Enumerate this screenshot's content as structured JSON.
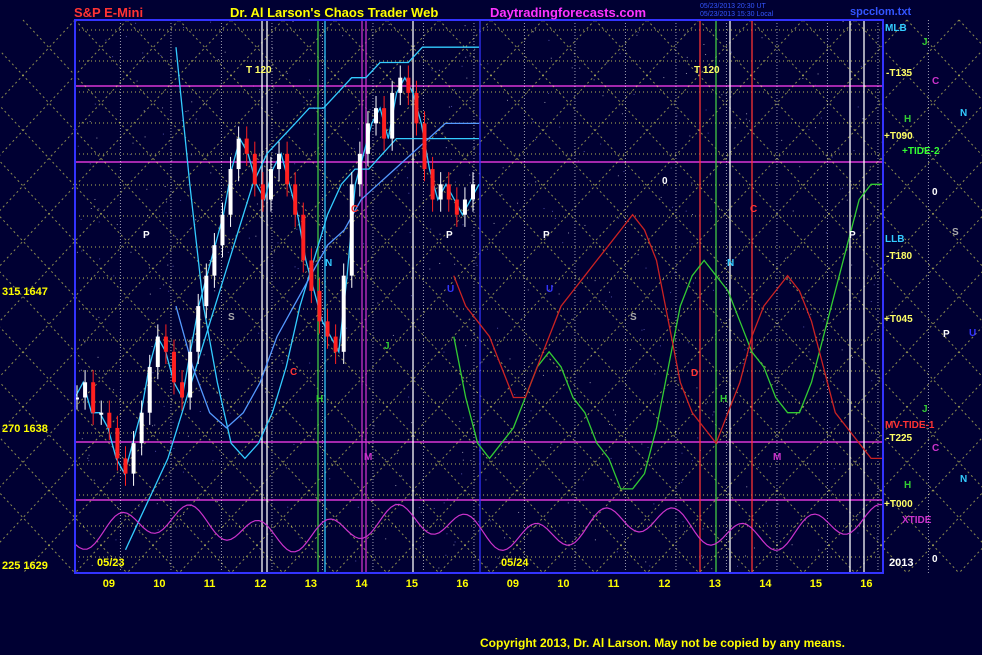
{
  "header": {
    "left_title": "S&P E-Mini",
    "center_title": "Dr. Al Larson's Chaos Trader Web",
    "site": "Daytradingforecasts.com",
    "file_name": "spcclom.txt",
    "timestamp_line1": "05/23/2013 20:30 UT",
    "timestamp_line2": "05/23/2013 15:30 Local"
  },
  "footer": {
    "copyright": "Copyright 2013, Dr. Al Larson. May not be copied by any means."
  },
  "colors": {
    "background": "#000033",
    "frame": "#3333ff",
    "price_up": "#ffffff",
    "price_down": "#ff2020",
    "grid_yellow": "#ffff66",
    "grid_magenta": "#cc33cc",
    "grid_green": "#44cc44",
    "tide_cyan": "#33ccff",
    "band_green": "#33cc33",
    "band_red": "#cc2222",
    "osc_magenta": "#cc33cc"
  },
  "chart_data": {
    "type": "candlestick",
    "title": "S&P E-Mini",
    "y_left_labels": [
      {
        "angle": "315",
        "price": "1647",
        "value": 1647
      },
      {
        "angle": "270",
        "price": "1638",
        "value": 1638
      },
      {
        "angle": "225",
        "price": "1629",
        "value": 1629
      }
    ],
    "ylim": [
      1629,
      1664
    ],
    "x_tick_labels": [
      "09",
      "10",
      "11",
      "12",
      "13",
      "14",
      "15",
      "16",
      "09",
      "10",
      "11",
      "12",
      "13",
      "14",
      "15",
      "16"
    ],
    "date_labels": [
      {
        "text": "05/23",
        "slot": 0
      },
      {
        "text": "05/24",
        "slot": 8
      }
    ],
    "year_label": "2013",
    "right_labels": [
      {
        "text": "MLB",
        "color": "#33ccff",
        "level": "top"
      },
      {
        "text": "J",
        "color": "#33cc33",
        "level": "top"
      },
      {
        "text": "-T135",
        "color": "#ffff66",
        "level": "top"
      },
      {
        "text": "C",
        "color": "#cc33cc",
        "level": "top"
      },
      {
        "text": "N",
        "color": "#33ccff",
        "level": "top"
      },
      {
        "text": "H",
        "color": "#33cc33",
        "level": "top"
      },
      {
        "text": "+T090",
        "color": "#ffff66",
        "level": "top"
      },
      {
        "text": "+TIDE-2",
        "color": "#33ff33",
        "level": "top"
      },
      {
        "text": "0",
        "color": "#ffffff",
        "level": "top"
      },
      {
        "text": "LLB",
        "color": "#33ccff",
        "level": "mid"
      },
      {
        "text": "S",
        "color": "#aaaaaa",
        "level": "mid"
      },
      {
        "text": "-T180",
        "color": "#ffff66",
        "level": "mid"
      },
      {
        "text": "+T045",
        "color": "#ffff66",
        "level": "mid"
      },
      {
        "text": "P",
        "color": "#ffffff",
        "level": "mid"
      },
      {
        "text": "U",
        "color": "#3333ff",
        "level": "mid"
      },
      {
        "text": "J",
        "color": "#33cc33",
        "level": "low"
      },
      {
        "text": "MV-TIDE-1",
        "color": "#ff3333",
        "level": "low"
      },
      {
        "text": "-T225",
        "color": "#ffff66",
        "level": "low"
      },
      {
        "text": "C",
        "color": "#cc33cc",
        "level": "low"
      },
      {
        "text": "N",
        "color": "#33ccff",
        "level": "low"
      },
      {
        "text": "H",
        "color": "#33cc33",
        "level": "low"
      },
      {
        "text": "+T000",
        "color": "#ffff66",
        "level": "low"
      },
      {
        "text": "XTIDE",
        "color": "#cc33cc",
        "level": "low"
      },
      {
        "text": "0",
        "color": "#ffffff",
        "level": "low"
      }
    ],
    "chart_annotations": [
      {
        "text": "T 120",
        "color": "#ffff66"
      },
      {
        "text": "T 120",
        "color": "#ffff66"
      },
      {
        "text": "P",
        "color": "#ffffff"
      },
      {
        "text": "S",
        "color": "#aaaaaa"
      },
      {
        "text": "N",
        "color": "#33ccff"
      },
      {
        "text": "J",
        "color": "#33cc33"
      },
      {
        "text": "H",
        "color": "#33cc33"
      },
      {
        "text": "M",
        "color": "#cc33cc"
      },
      {
        "text": "C",
        "color": "#ff3333"
      },
      {
        "text": "U",
        "color": "#3333ff"
      },
      {
        "text": "0",
        "color": "#ffffff"
      }
    ],
    "series": [
      {
        "values": [
          1640,
          1641,
          1639,
          1639,
          1638,
          1636,
          1635,
          1637,
          1639,
          1642,
          1644,
          1643,
          1641,
          1640,
          1643,
          1646,
          1648,
          1650,
          1652,
          1655,
          1657,
          1656,
          1654,
          1653,
          1655,
          1656,
          1654,
          1652,
          1649,
          1647,
          1645,
          1644,
          1643,
          1648,
          1654,
          1656,
          1658,
          1659,
          1657,
          1660,
          1661,
          1660,
          1658,
          1655,
          1653,
          1654,
          1653,
          1652,
          1653,
          1654
        ]
      },
      {
        "values": [
          1630,
          1632,
          1634,
          1636,
          1639,
          1642,
          1645,
          1648,
          1651,
          1654,
          1656,
          1657,
          1658,
          1659,
          1659,
          1660,
          1661,
          1661,
          1662,
          1662,
          1662,
          1663,
          1663,
          1663,
          1663,
          1663
        ]
      },
      {
        "values": [
          1663,
          1654,
          1646,
          1641,
          1637,
          1636,
          1637,
          1639,
          1642,
          1646,
          1649,
          1652,
          1654,
          1655,
          1655,
          1656,
          1657,
          1657,
          1657,
          1657,
          1657,
          1657,
          1657
        ]
      },
      {
        "values": [
          1646,
          1642,
          1639,
          1638,
          1639,
          1641,
          1644,
          1646,
          1648,
          1650,
          1651,
          1653,
          1654,
          1655,
          1656,
          1657,
          1658,
          1658,
          1658
        ]
      },
      {
        "values": [
          1644,
          1640,
          1637,
          1636,
          1637,
          1638,
          1640,
          1642,
          1643,
          1642,
          1640,
          1639,
          1637,
          1636,
          1634,
          1634,
          1635,
          1638,
          1642,
          1646,
          1648,
          1649,
          1648,
          1647,
          1645,
          1643,
          1642,
          1640,
          1639,
          1639,
          1641,
          1644,
          1647,
          1650,
          1653,
          1654,
          1654
        ]
      },
      {
        "values": [
          1648,
          1646,
          1645,
          1644,
          1642,
          1640,
          1640,
          1642,
          1644,
          1646,
          1647,
          1648,
          1649,
          1650,
          1651,
          1652,
          1651,
          1649,
          1645,
          1641,
          1639,
          1638,
          1637,
          1639,
          1641,
          1644,
          1646,
          1647,
          1648,
          1647,
          1645,
          1642,
          1639,
          1638,
          1637,
          1636,
          1636
        ]
      }
    ]
  }
}
